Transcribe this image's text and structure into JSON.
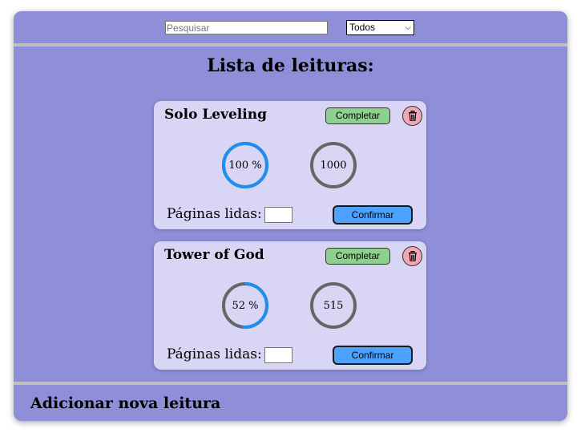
{
  "header": {
    "search_placeholder": "Pesquisar",
    "filter_selected": "Todos"
  },
  "main": {
    "title": "Lista de leituras:"
  },
  "readings": [
    {
      "title": "Solo Leveling",
      "complete_label": "Completar",
      "progress_text": "100 %",
      "progress_fraction": 1.0,
      "pages_total": "1000",
      "pages_label": "Páginas lidas:",
      "confirm_label": "Confirmar"
    },
    {
      "title": "Tower of God",
      "complete_label": "Completar",
      "progress_text": "52 %",
      "progress_fraction": 0.52,
      "pages_total": "515",
      "pages_label": "Páginas lidas:",
      "confirm_label": "Confirmar"
    }
  ],
  "footer": {
    "title": "Adicionar nova leitura"
  },
  "icons": {
    "delete": "trash-icon"
  },
  "colors": {
    "background": "#8e8ed9",
    "card": "#d8d6f4",
    "progress": "#1f8ef1",
    "ring_total": "#666666",
    "complete_button": "#8ed18e",
    "delete_button": "#f2a8b4",
    "confirm_button": "#4da1ff"
  }
}
